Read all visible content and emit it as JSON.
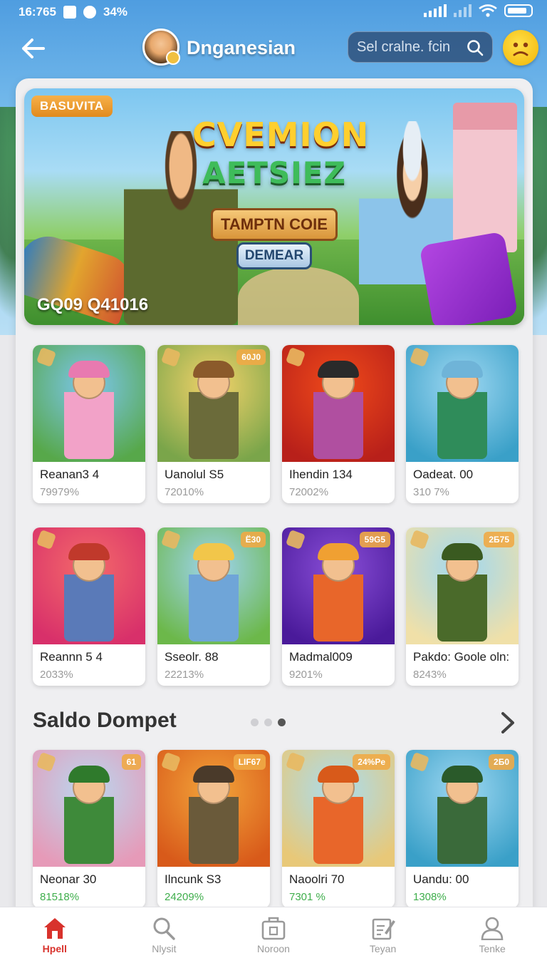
{
  "status_bar": {
    "time": "16:765",
    "battery_percent": "34%"
  },
  "header": {
    "username": "Dnganesian",
    "search_placeholder": "Sel cralne. fcin"
  },
  "banner": {
    "badge": "BASUVITA",
    "title_line1": "CVEMION",
    "title_line2": "AETSIEZ",
    "ribbon": "TAMPTN COIE",
    "button": "DEMEAR",
    "code": "GQ09 Q41016"
  },
  "games_row1": [
    {
      "name": "Reanan3 4",
      "pct": "79979%",
      "tag": "",
      "colors": [
        "#7cc6ef",
        "#57a84a",
        "#f2a2c8",
        "#e87ab0"
      ]
    },
    {
      "name": "Uanolul S5",
      "pct": "72010%",
      "tag": "60J0",
      "colors": [
        "#f5d36a",
        "#7aa54a",
        "#6b6b3a",
        "#8b5a2b"
      ]
    },
    {
      "name": "Ihendin 134",
      "pct": "72002%",
      "tag": "",
      "colors": [
        "#f04a1a",
        "#b8201a",
        "#b04fa0",
        "#2a2a2a"
      ]
    },
    {
      "name": "Oadeat. 00",
      "pct": "310 7%",
      "tag": "",
      "colors": [
        "#9fd8f2",
        "#3aa0c8",
        "#2f8c5a",
        "#6fb4d8"
      ]
    }
  ],
  "games_row2": [
    {
      "name": "Reannn 5 4",
      "pct": "2033%",
      "tag": "",
      "colors": [
        "#f46a6a",
        "#d8306a",
        "#5a7ab8",
        "#c0392b"
      ]
    },
    {
      "name": "Sseolr. 88",
      "pct": "22213%",
      "tag": "Ё30",
      "colors": [
        "#9fd4f4",
        "#6cb84a",
        "#6fa5d8",
        "#f2c64a"
      ]
    },
    {
      "name": "Madmal009",
      "pct": "9201%",
      "tag": "59G5",
      "colors": [
        "#8a4fd8",
        "#4a1a9a",
        "#e8662a",
        "#f0a032"
      ]
    },
    {
      "name": "Pakdo: Goole oln:",
      "pct": "8243%",
      "tag": "2Б75",
      "colors": [
        "#9fd8f2",
        "#f0e0a8",
        "#4a6a2a",
        "#3a5a20"
      ]
    }
  ],
  "section": {
    "title": "Saldo Dompet"
  },
  "games_row3": [
    {
      "name": "Neonar 30",
      "pct": "81518%",
      "tag": "61",
      "colors": [
        "#b9d8f0",
        "#e69ab8",
        "#3e8a3a",
        "#2f7a2c"
      ]
    },
    {
      "name": "Ilncunk S3",
      "pct": "24209%",
      "tag": "LIF67",
      "colors": [
        "#f3a53a",
        "#d85a1a",
        "#6a5a3a",
        "#4a3a2a"
      ]
    },
    {
      "name": "Naoolri 70",
      "pct": "7301 %",
      "tag": "24%Pe",
      "colors": [
        "#a8ddf2",
        "#e8c878",
        "#e8662a",
        "#d85a1a"
      ]
    },
    {
      "name": "Uandu: 00",
      "pct": "1308%",
      "tag": "2Б0",
      "colors": [
        "#9fd8f2",
        "#3aa0c8",
        "#3a6a3a",
        "#2a5a2a"
      ]
    }
  ],
  "bottom_nav": [
    {
      "label": "Hpell",
      "icon": "home-icon",
      "active": true
    },
    {
      "label": "Nlysit",
      "icon": "search-icon",
      "active": false
    },
    {
      "label": "Noroon",
      "icon": "briefcase-icon",
      "active": false
    },
    {
      "label": "Teyan",
      "icon": "edit-icon",
      "active": false
    },
    {
      "label": "Tenke",
      "icon": "user-icon",
      "active": false
    }
  ],
  "colors": {
    "accent": "#d8322c",
    "green_pct": "#3fae4c",
    "panel_bg": "#efeff1"
  }
}
